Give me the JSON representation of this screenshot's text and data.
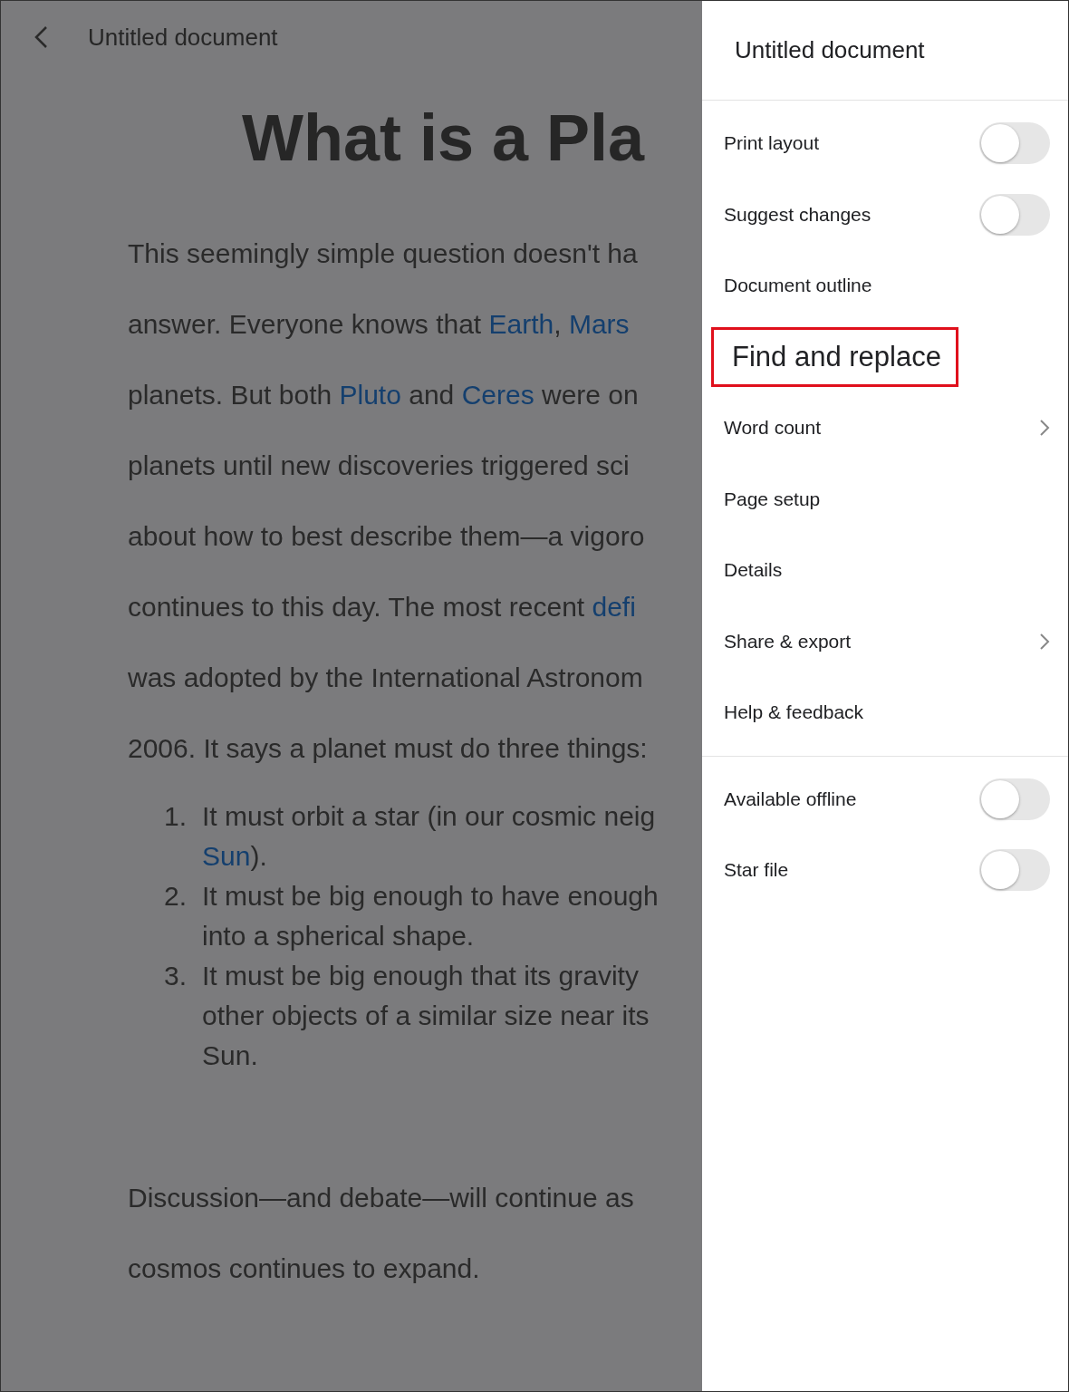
{
  "top_bar": {
    "title": "Untitled document"
  },
  "document": {
    "heading": "What is a Pla",
    "paragraphs": [
      [
        [
          {
            "text": "This seemingly simple question doesn't ha"
          }
        ],
        [
          {
            "text": "answer. Everyone knows that "
          },
          {
            "text": "Earth",
            "link": true
          },
          {
            "text": ", "
          },
          {
            "text": "Mars",
            "link": true
          }
        ],
        [
          {
            "text": "planets. But both "
          },
          {
            "text": "Pluto",
            "link": true
          },
          {
            "text": " and "
          },
          {
            "text": "Ceres",
            "link": true
          },
          {
            "text": " were on"
          }
        ],
        [
          {
            "text": "planets until new discoveries triggered sci"
          }
        ],
        [
          {
            "text": "about how to best describe them—a vigoro"
          }
        ],
        [
          {
            "text": "continues to this day. The most recent "
          },
          {
            "text": "defi",
            "link": true
          }
        ],
        [
          {
            "text": "was adopted by the International Astronom"
          }
        ],
        [
          {
            "text": "2006. It says a planet must do three things:"
          }
        ]
      ],
      [
        [
          {
            "text": "Discussion—and debate—will continue as"
          }
        ],
        [
          {
            "text": "cosmos continues to expand."
          }
        ]
      ]
    ],
    "list": [
      {
        "number": "1.",
        "lines": [
          [
            {
              "text": "It must orbit a star (in our cosmic neig"
            }
          ],
          [
            {
              "text": "Sun",
              "link": true
            },
            {
              "text": ")."
            }
          ]
        ]
      },
      {
        "number": "2.",
        "lines": [
          [
            {
              "text": "It must be big enough to have enough"
            }
          ],
          [
            {
              "text": "into a spherical shape."
            }
          ]
        ]
      },
      {
        "number": "3.",
        "lines": [
          [
            {
              "text": "It must be big enough that its gravity"
            }
          ],
          [
            {
              "text": "other objects of a similar size near its"
            }
          ],
          [
            {
              "text": "Sun."
            }
          ]
        ]
      }
    ]
  },
  "menu": {
    "title": "Untitled document",
    "sections": [
      [
        {
          "label": "Print layout",
          "kind": "toggle",
          "on": false
        },
        {
          "label": "Suggest changes",
          "kind": "toggle",
          "on": false
        },
        {
          "label": "Document outline",
          "kind": "plain"
        },
        {
          "label": "Find and replace",
          "kind": "plain",
          "highlighted": true
        },
        {
          "label": "Word count",
          "kind": "submenu"
        },
        {
          "label": "Page setup",
          "kind": "plain"
        },
        {
          "label": "Details",
          "kind": "plain"
        },
        {
          "label": "Share & export",
          "kind": "submenu"
        },
        {
          "label": "Help & feedback",
          "kind": "plain"
        }
      ],
      [
        {
          "label": "Available offline",
          "kind": "toggle",
          "on": false
        },
        {
          "label": "Star file",
          "kind": "toggle",
          "on": false
        }
      ]
    ]
  }
}
